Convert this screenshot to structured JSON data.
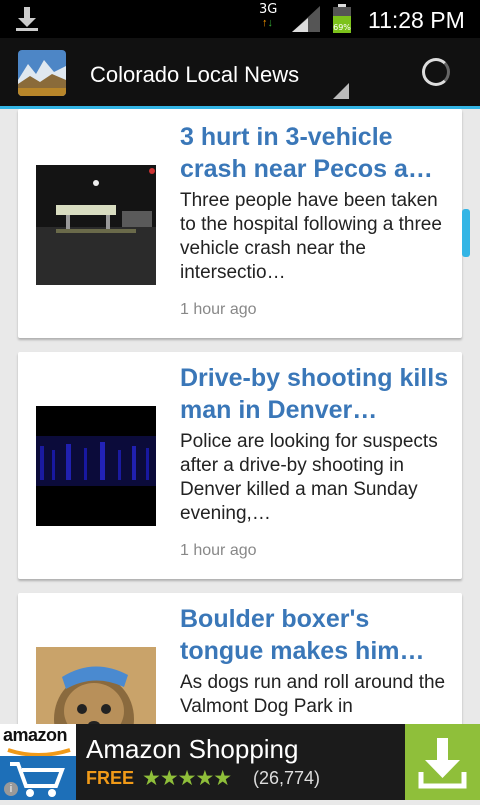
{
  "status_bar": {
    "network": "3G",
    "battery": "69%",
    "time": "11:28 PM"
  },
  "action_bar": {
    "title": "Colorado Local News"
  },
  "articles": [
    {
      "headline": "3 hurt in 3-vehicle crash near Pecos a…",
      "summary": "Three people have been taken to the hospital following a three vehicle crash near the intersectio…",
      "age": "1 hour ago"
    },
    {
      "headline": "Drive-by shooting kills man in Denver…",
      "summary": "Police are looking for suspects after a drive-by shooting in Denver killed a man Sunday evening,…",
      "age": "1 hour ago"
    },
    {
      "headline": "Boulder boxer's tongue makes him…",
      "summary": "As dogs run and roll around the Valmont Dog Park in"
    }
  ],
  "ad": {
    "brand": "amazon",
    "title": "Amazon Shopping",
    "price": "FREE",
    "stars": "★★★★★",
    "rating": 4.5,
    "review_count": "(26,774)"
  },
  "colors": {
    "accent": "#33b5e5",
    "headline": "#3a77b8",
    "ad_green": "#8fbf3a",
    "ad_orange": "#f19a18"
  }
}
